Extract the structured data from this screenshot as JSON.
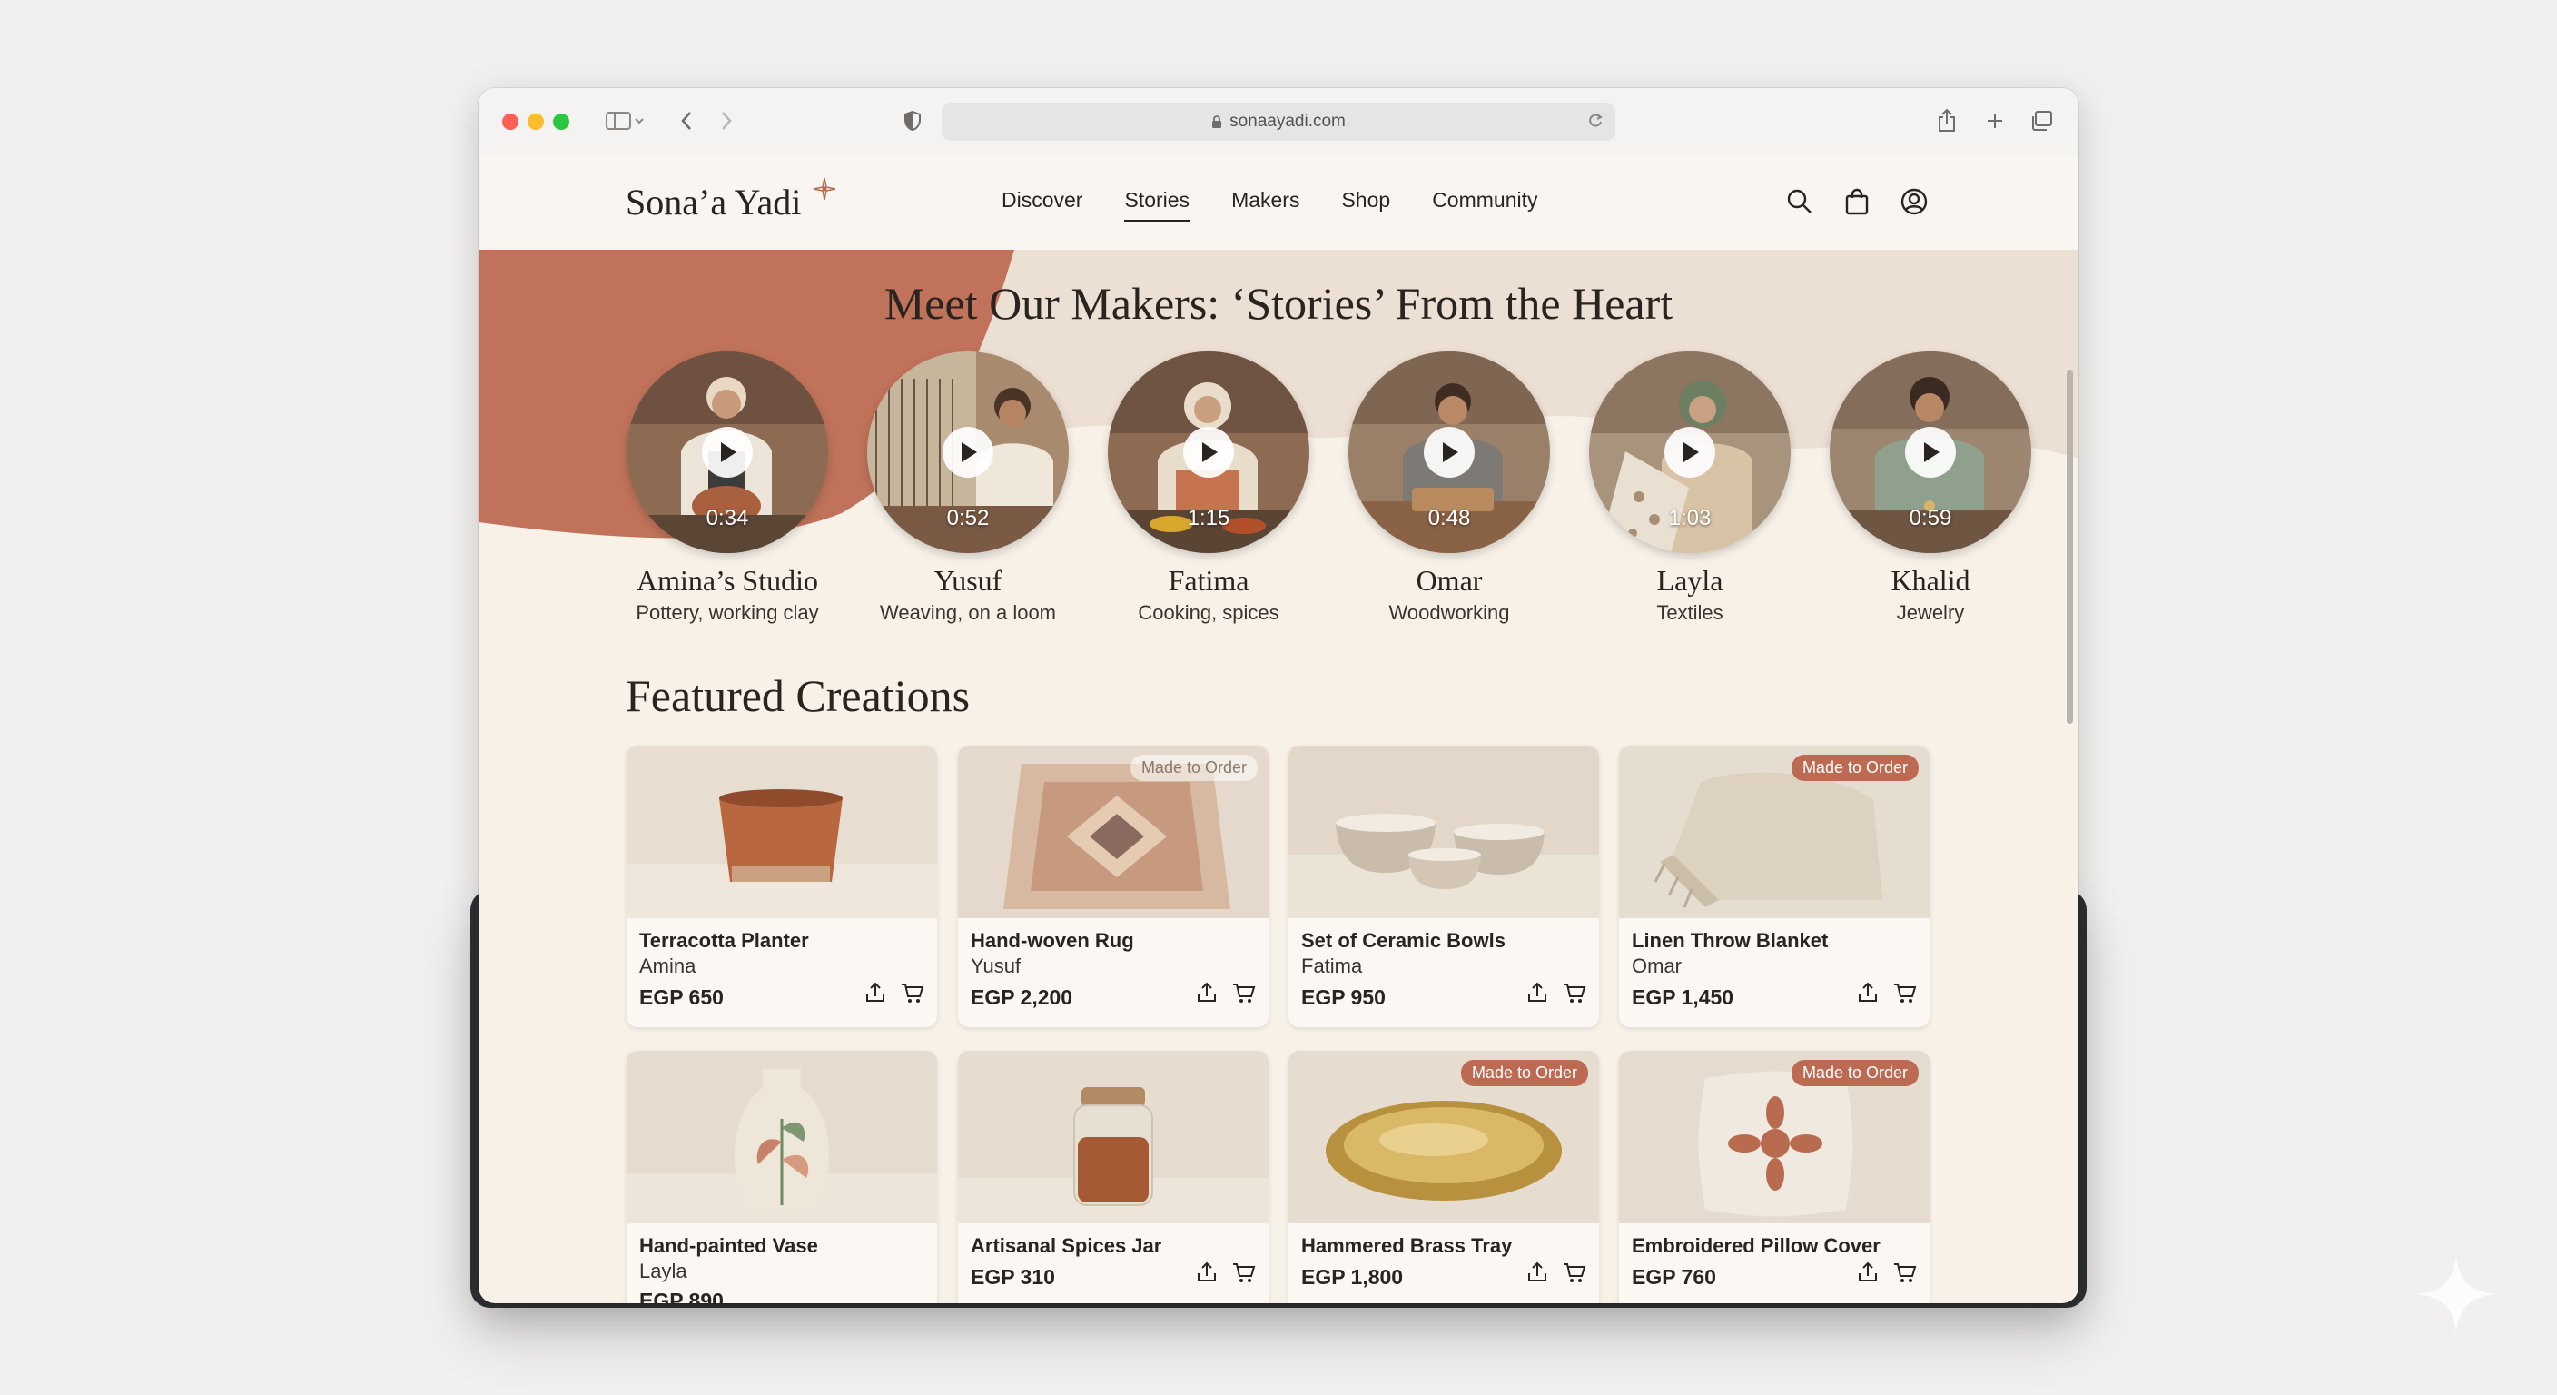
{
  "browser": {
    "url": "sonaayadi.com"
  },
  "site": {
    "logo": "Sona’a Yadi",
    "nav": [
      "Discover",
      "Stories",
      "Makers",
      "Shop",
      "Community"
    ],
    "active_nav": "Stories"
  },
  "hero": {
    "title": "Meet Our Makers: ‘Stories’ From the Heart",
    "makers": [
      {
        "name": "Amina’s Studio",
        "desc": "Pottery, working clay",
        "duration": "0:34"
      },
      {
        "name": "Yusuf",
        "desc": "Weaving, on a loom",
        "duration": "0:52"
      },
      {
        "name": "Fatima",
        "desc": "Cooking, spices",
        "duration": "1:15"
      },
      {
        "name": "Omar",
        "desc": "Woodworking",
        "duration": "0:48"
      },
      {
        "name": "Layla",
        "desc": "Textiles",
        "duration": "1:03"
      },
      {
        "name": "Khalid",
        "desc": "Jewelry",
        "duration": "0:59"
      }
    ]
  },
  "featured": {
    "title": "Featured Creations",
    "products": [
      {
        "name": "Terracotta Planter",
        "maker": "Amina",
        "price": "EGP 650",
        "badge": ""
      },
      {
        "name": "Hand-woven Rug",
        "maker": "Yusuf",
        "price": "EGP 2,200",
        "badge": "Made to Order"
      },
      {
        "name": "Set of Ceramic Bowls",
        "maker": "Fatima",
        "price": "EGP 950",
        "badge": ""
      },
      {
        "name": "Linen Throw Blanket",
        "maker": "Omar",
        "price": "EGP 1,450",
        "badge": "Made to Order"
      },
      {
        "name": "Hand-painted Vase",
        "maker": "Layla",
        "price": "EGP 890",
        "badge": ""
      },
      {
        "name": "Artisanal Spices Jar",
        "maker": "",
        "price": "EGP 310",
        "badge": ""
      },
      {
        "name": "Hammered Brass Tray",
        "maker": "",
        "price": "EGP 1,800",
        "badge": "Made to Order"
      },
      {
        "name": "Embroidered Pillow Cover",
        "maker": "",
        "price": "EGP 760",
        "badge": "Made to Order"
      }
    ]
  },
  "colors": {
    "accent": "#bd6a52",
    "background": "#f7f1e8",
    "hero_shape": "#c0735a"
  }
}
